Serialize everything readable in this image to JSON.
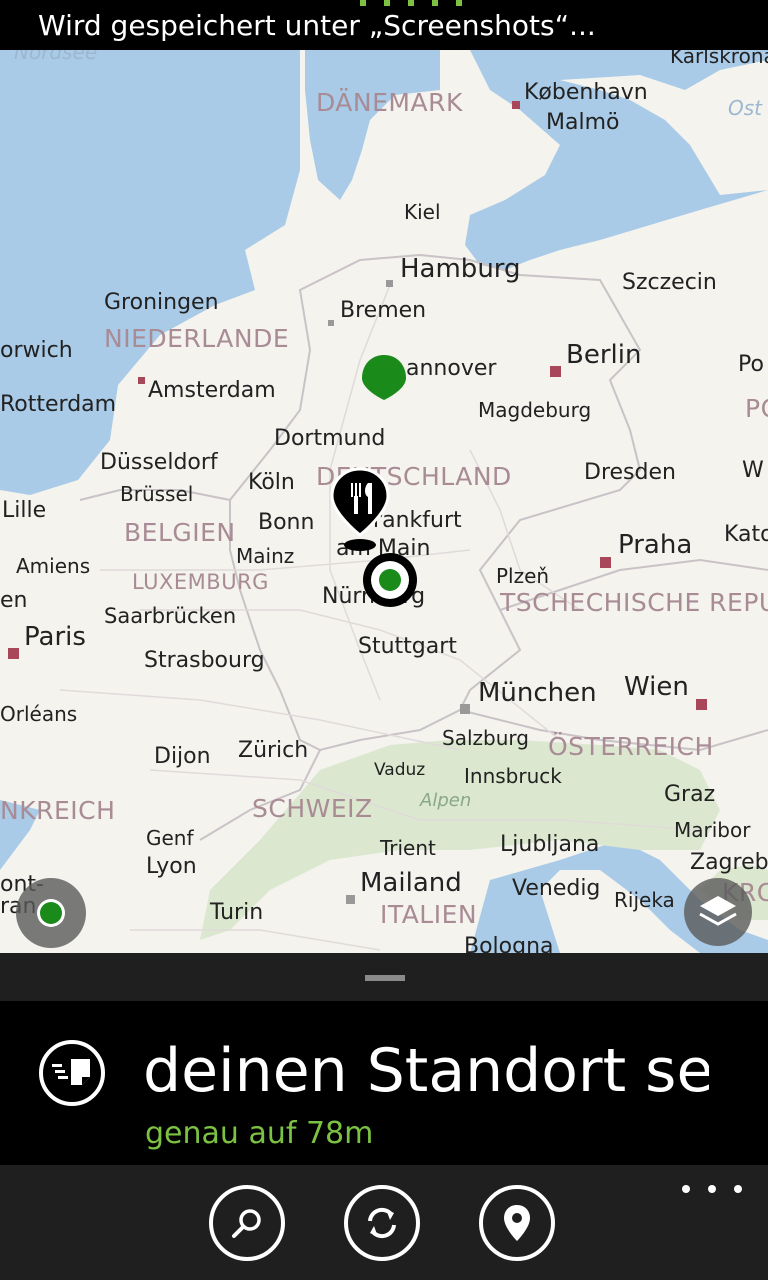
{
  "status_bar": {
    "text": "Wird gespeichert unter „Screenshots“..."
  },
  "map": {
    "labels": {
      "nordsee": "Nordsee",
      "dänemark": "DÄNEMARK",
      "kobenhavn": "København",
      "malmo": "Malmö",
      "ostsee": "Ost",
      "karlskrona": "Karlskrona",
      "kiel": "Kiel",
      "hamburg": "Hamburg",
      "szczecin": "Szczecin",
      "groningen": "Groningen",
      "bremen": "Bremen",
      "niederlande": "NIEDERLANDE",
      "norwich": "orwich",
      "berlin": "Berlin",
      "hannover": "annover",
      "po": "Po",
      "po2": "PO",
      "amsterdam": "Amsterdam",
      "rotterdam": "Rotterdam",
      "magdeburg": "Magdeburg",
      "dortmund": "Dortmund",
      "dusseldorf": "Düsseldorf",
      "koln": "Köln",
      "deutschland": "DEUTSCHLAND",
      "dresden": "Dresden",
      "w": "W",
      "lille": "Lille",
      "brussel": "Brüssel",
      "bonn": "Bonn",
      "frankfurt": "Frankfurt",
      "am_main": "am Main",
      "belgien": "BELGIEN",
      "kato": "Kato",
      "praha": "Praha",
      "amiens": "Amiens",
      "mainz": "Mainz",
      "luxemburg": "LUXEMBURG",
      "plzen": "Plzeň",
      "en": "en",
      "saarbrucken": "Saarbrücken",
      "nurnberg": "Nürnberg",
      "tschechische": "TSCHECHISCHE REPU",
      "paris": "Paris",
      "stuttgart": "Stuttgart",
      "strasbourg": "Strasbourg",
      "munchen": "München",
      "wien": "Wien",
      "orleans": "Orléans",
      "salzburg": "Salzburg",
      "osterreich": "ÖSTERREICH",
      "dijon": "Dijon",
      "zurich": "Zürich",
      "vaduz": "Vaduz",
      "innsbruck": "Innsbruck",
      "graz": "Graz",
      "frankreich": "NKREICH",
      "schweiz": "SCHWEIZ",
      "alpen": "Alpen",
      "maribor": "Maribor",
      "genf": "Genf",
      "trient": "Trient",
      "ljubljana": "Ljubljana",
      "lyon": "Lyon",
      "zagreb": "Zagreb",
      "mailand": "Mailand",
      "venedig": "Venedig",
      "rijeka": "Rijeka",
      "kroa": "KROA",
      "clermont": "ont-",
      "ferrand": "ran",
      "turin": "Turin",
      "italien": "ITALIEN",
      "bologna": "Bologna"
    }
  },
  "panel": {
    "title": "deinen Standort senden",
    "accuracy": "genau auf 78m"
  },
  "colors": {
    "accent": "#7cc242",
    "location_green": "#1a8a1a",
    "water": "#a9cbe7",
    "land": "#f4f3ee",
    "mountains": "#dbe8cf",
    "country_label": "#a88b95"
  },
  "icons": {
    "search": "search-icon",
    "refresh": "refresh-icon",
    "map_pin": "map-pin-icon",
    "restaurant": "restaurant-pin-icon",
    "layers": "layers-icon",
    "share": "share-location-icon"
  }
}
